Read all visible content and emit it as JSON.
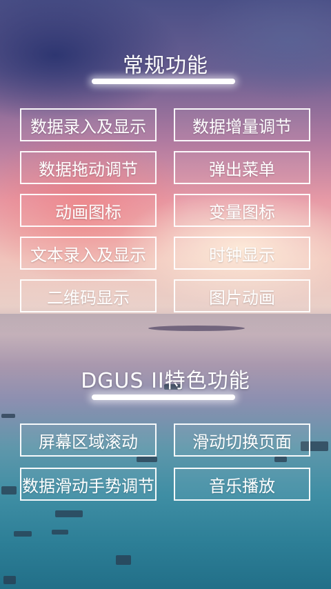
{
  "sections": {
    "regular": {
      "title": "常规功能",
      "buttons": [
        "数据录入及显示",
        "数据增量调节",
        "数据拖动调节",
        "弹出菜单",
        "动画图标",
        "变量图标",
        "文本录入及显示",
        "时钟显示",
        "二维码显示",
        "图片动画"
      ]
    },
    "dgus": {
      "title": "DGUS II特色功能",
      "buttons": [
        "屏幕区域滚动",
        "滑动切换页面",
        "数据滑动手势调节",
        "音乐播放"
      ]
    }
  },
  "colors": {
    "button_border": "#ffffff",
    "text": "#ffffff"
  }
}
